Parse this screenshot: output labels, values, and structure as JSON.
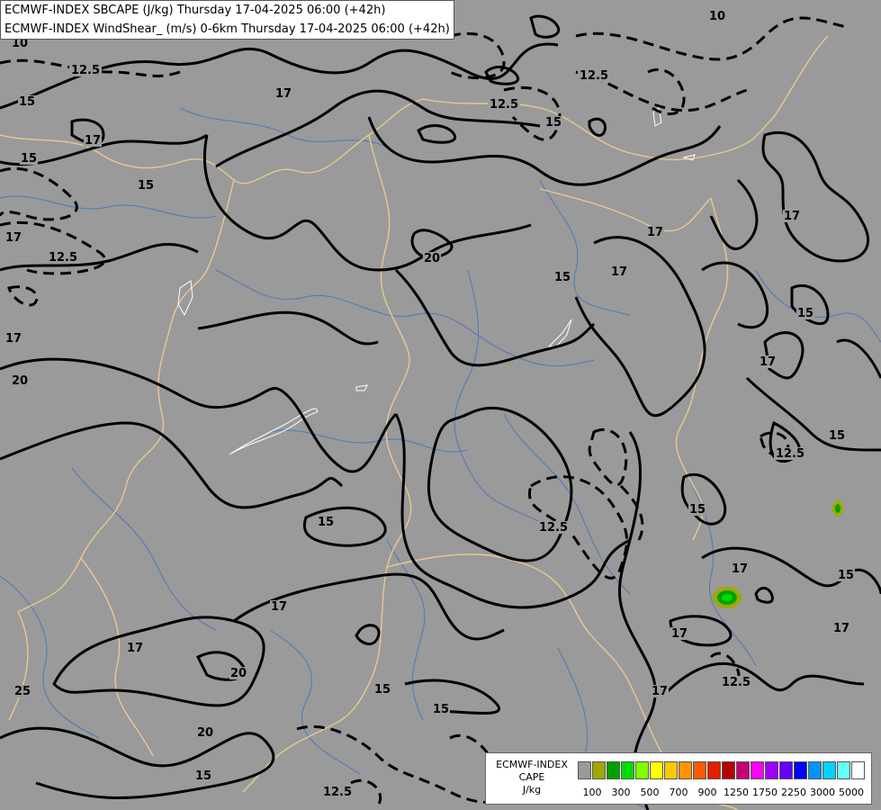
{
  "header": {
    "line1": "ECMWF-INDEX SBCAPE (J/kg) Thursday 17-04-2025 06:00 (+42h)",
    "line2": "ECMWF-INDEX WindShear_ (m/s) 0-6km Thursday 17-04-2025 06:00 (+42h)"
  },
  "legend": {
    "title1": "ECMWF-INDEX",
    "title2": "CAPE",
    "unit": "J/kg",
    "colors": [
      "#9a9a9a",
      "#a0a800",
      "#00a000",
      "#00dc00",
      "#80ff00",
      "#ffff00",
      "#ffc800",
      "#ff9600",
      "#ff5a00",
      "#e61e00",
      "#b40000",
      "#c80078",
      "#ff00ff",
      "#a000ff",
      "#6400ff",
      "#0000ff",
      "#0096ff",
      "#00d2ff",
      "#64ffff",
      "#ffffff"
    ],
    "ticks": [
      "100",
      "300",
      "500",
      "700",
      "900",
      "1250",
      "1750",
      "2250",
      "3000",
      "5000"
    ]
  },
  "contour_labels": [
    {
      "text": "10"
    },
    {
      "text": "10"
    },
    {
      "text": "12.5"
    },
    {
      "text": "12.5"
    },
    {
      "text": "12.5"
    },
    {
      "text": "12.5"
    },
    {
      "text": "15"
    },
    {
      "text": "15"
    },
    {
      "text": "15"
    },
    {
      "text": "17"
    },
    {
      "text": "17"
    },
    {
      "text": "17"
    },
    {
      "text": "17"
    },
    {
      "text": "17"
    },
    {
      "text": "17"
    },
    {
      "text": "20"
    },
    {
      "text": "20"
    },
    {
      "text": "15"
    },
    {
      "text": "15"
    },
    {
      "text": "15"
    },
    {
      "text": "17"
    },
    {
      "text": "12.5"
    },
    {
      "text": "12.5"
    },
    {
      "text": "15"
    },
    {
      "text": "17"
    },
    {
      "text": "17"
    },
    {
      "text": "15"
    },
    {
      "text": "17"
    },
    {
      "text": "17"
    },
    {
      "text": "12.5"
    },
    {
      "text": "17"
    },
    {
      "text": "20"
    },
    {
      "text": "25"
    },
    {
      "text": "20"
    },
    {
      "text": "15"
    },
    {
      "text": "15"
    },
    {
      "text": "15"
    },
    {
      "text": "12.5"
    },
    {
      "text": "17"
    },
    {
      "text": "15"
    },
    {
      "text": "17"
    },
    {
      "text": "15"
    }
  ]
}
